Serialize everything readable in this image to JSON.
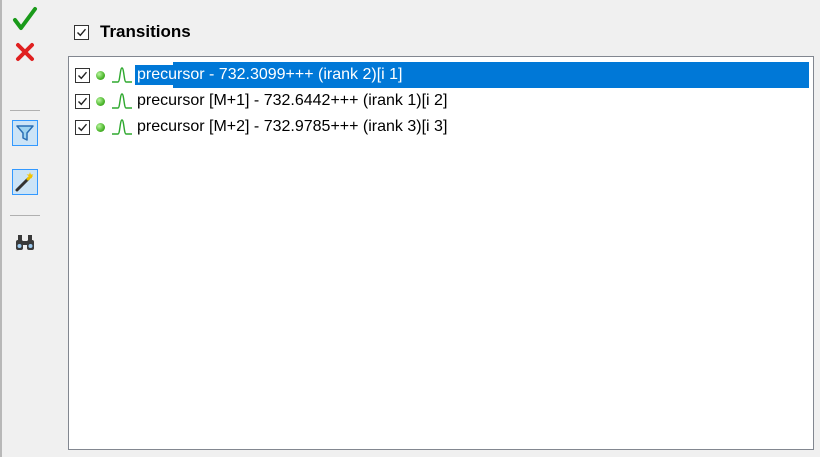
{
  "header": {
    "title": "Transitions",
    "checked": true
  },
  "toolbar": {
    "buttons": [
      {
        "name": "accept-icon"
      },
      {
        "name": "cancel-icon"
      },
      {
        "name": "filter-icon",
        "checked": true
      },
      {
        "name": "magic-wand-icon",
        "checked": true
      },
      {
        "name": "binoculars-icon"
      }
    ]
  },
  "transitions": [
    {
      "label": "precursor - 732.3099+++ (irank 2)[i 1]",
      "checked": true,
      "selected": true
    },
    {
      "label": "precursor [M+1] - 732.6442+++ (irank 1)[i 2]",
      "checked": true,
      "selected": false
    },
    {
      "label": "precursor [M+2] - 732.9785+++ (irank 3)[i 3]",
      "checked": true,
      "selected": false
    }
  ],
  "colors": {
    "selection": "#0078d7",
    "peak": "#2ea82e",
    "cancel": "#e02020",
    "accept": "#1a9a1a"
  }
}
